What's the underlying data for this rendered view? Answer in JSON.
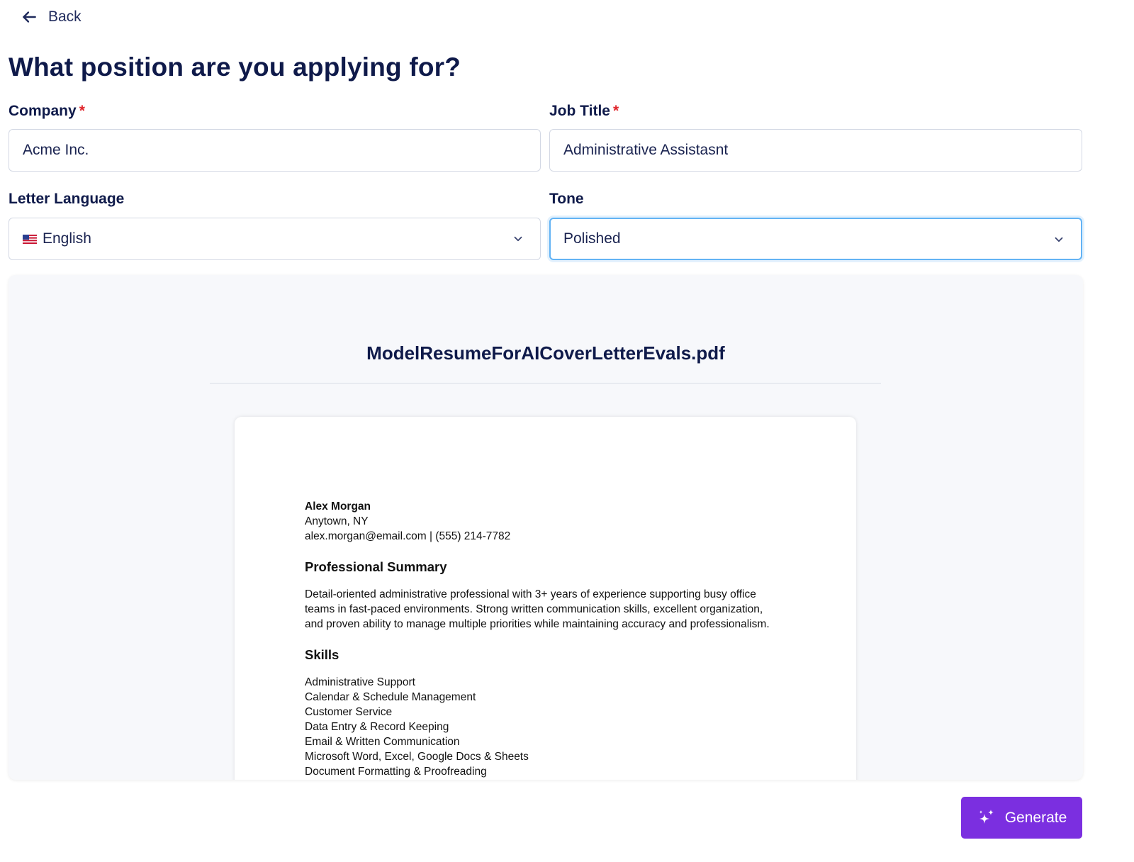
{
  "nav": {
    "back_label": "Back"
  },
  "form": {
    "title": "What position are you applying for?",
    "company": {
      "label": "Company",
      "required_mark": "*",
      "value": "Acme Inc."
    },
    "job_title": {
      "label": "Job Title",
      "required_mark": "*",
      "value": "Administrative Assistasnt"
    },
    "language": {
      "label": "Letter Language",
      "value": "English",
      "flag_icon": "us-flag-icon"
    },
    "tone": {
      "label": "Tone",
      "value": "Polished"
    }
  },
  "preview": {
    "filename": "ModelResumeForAICoverLetterEvals.pdf",
    "resume": {
      "name": "Alex Morgan",
      "location": "Anytown, NY",
      "contact": "alex.morgan@email.com | (555) 214-7782",
      "summary_heading": "Professional Summary",
      "summary_lines": [
        "Detail-oriented administrative professional with 3+ years of experience supporting busy office",
        "teams in fast-paced environments. Strong written communication skills, excellent organization,",
        "and proven ability to manage multiple priorities while maintaining accuracy and professionalism."
      ],
      "skills_heading": "Skills",
      "skills": [
        "Administrative Support",
        "Calendar & Schedule Management",
        "Customer Service",
        "Data Entry & Record Keeping",
        "Email & Written Communication",
        "Microsoft Word, Excel, Google Docs & Sheets",
        "Document Formatting & Proofreading"
      ]
    }
  },
  "actions": {
    "generate_label": "Generate",
    "generate_icon": "sparkle-icon"
  },
  "colors": {
    "accent": "#7b2fe0",
    "focus_border": "#63b3f4",
    "required": "#e0252b",
    "heading": "#0f1a4a"
  }
}
